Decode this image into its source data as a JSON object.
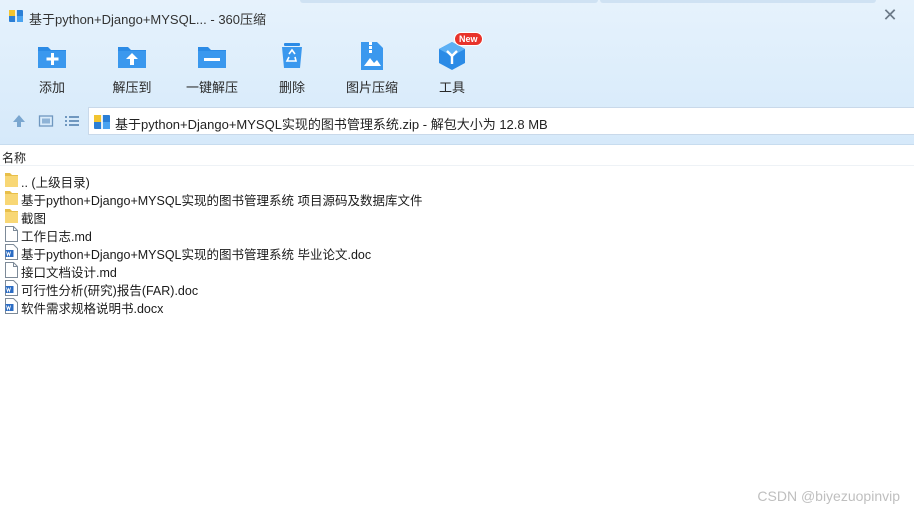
{
  "window": {
    "title": "基于python+Django+MYSQL... - 360压缩",
    "close_glyph": "✕"
  },
  "toolbar": [
    {
      "label": "添加",
      "icon": "add-folder-icon"
    },
    {
      "label": "解压到",
      "icon": "extract-to-folder-icon"
    },
    {
      "label": "一键解压",
      "icon": "one-click-extract-icon"
    },
    {
      "label": "删除",
      "icon": "recycle-bin-icon"
    },
    {
      "label": "图片压缩",
      "icon": "image-compress-icon"
    },
    {
      "label": "工具",
      "icon": "tools-cube-icon",
      "badge": "New"
    }
  ],
  "nav": {
    "up_icon": "up-arrow-icon",
    "thumbnail_view_icon": "thumbnail-view-icon",
    "list_view_icon": "list-view-icon"
  },
  "address": {
    "text": "基于python+Django+MYSQL实现的图书管理系统.zip - 解包大小为 12.8 MB",
    "icon": "zip-archive-icon"
  },
  "file_list": {
    "column_header": "名称",
    "items": [
      {
        "name": ".. (上级目录)",
        "type": "folder"
      },
      {
        "name": "基于python+Django+MYSQL实现的图书管理系统 项目源码及数据库文件",
        "type": "folder"
      },
      {
        "name": "截图",
        "type": "folder"
      },
      {
        "name": "工作日志.md",
        "type": "file"
      },
      {
        "name": "基于python+Django+MYSQL实现的图书管理系统 毕业论文.doc",
        "type": "word"
      },
      {
        "name": "接口文档设计.md",
        "type": "file"
      },
      {
        "name": "可行性分析(研究)报告(FAR).doc",
        "type": "word"
      },
      {
        "name": "软件需求规格说明书.docx",
        "type": "word"
      }
    ]
  },
  "watermark": "CSDN @biyezuopinvip",
  "colors": {
    "accent_blue": "#2b8be6",
    "chrome_bg": "#dcedfb",
    "folder_yellow": "#f8d775",
    "badge_red": "#e8332b"
  }
}
